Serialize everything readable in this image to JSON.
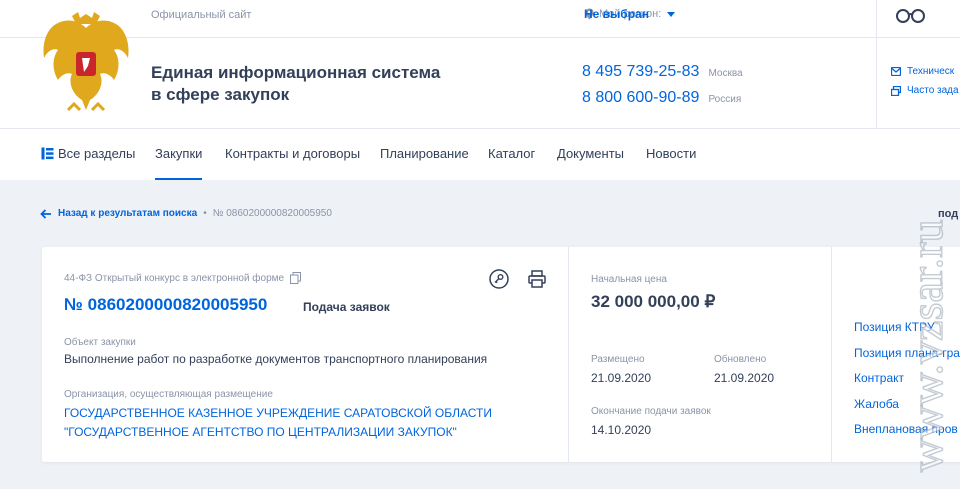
{
  "topbar": {
    "official_label": "Официальный сайт",
    "region_label": "Мой регион:",
    "region_value": "Не выбран"
  },
  "header": {
    "site_title_line1": "Единая информационная система",
    "site_title_line2": "в сфере закупок",
    "phones": [
      {
        "number": "8 495 739-25-83",
        "city": "Москва"
      },
      {
        "number": "8 800 600-90-89",
        "city": "Россия"
      }
    ],
    "support": [
      {
        "label": "Техническ",
        "icon": "envelope-icon"
      },
      {
        "label": "Часто зада",
        "icon": "faq-icon"
      }
    ]
  },
  "nav": {
    "items": [
      {
        "label": "Все разделы"
      },
      {
        "label": "Закупки"
      },
      {
        "label": "Контракты и договоры"
      },
      {
        "label": "Планирование"
      },
      {
        "label": "Каталог"
      },
      {
        "label": "Документы"
      },
      {
        "label": "Новости"
      }
    ],
    "active": "Закупки"
  },
  "breadcrumb": {
    "back_label": "Назад к результатам поиска",
    "separator": "•",
    "current": "№ 0860200000820005950",
    "right_partial": "под"
  },
  "card": {
    "law": "44-ФЗ Открытый конкурс в электронной форме",
    "number": "№ 0860200000820005950",
    "status": "Подача заявок",
    "object_label": "Объект закупки",
    "object_value": "Выполнение работ по разработке документов транспортного планирования",
    "org_label": "Организация, осуществляющая размещение",
    "org_line1": "ГОСУДАРСТВЕННОЕ КАЗЕННОЕ УЧРЕЖДЕНИЕ САРАТОВСКОЙ ОБЛАСТИ",
    "org_line2": "\"ГОСУДАРСТВЕННОЕ АГЕНТСТВО ПО ЦЕНТРАЛИЗАЦИИ ЗАКУПОК\"",
    "price_label": "Начальная цена",
    "price_value": "32 000 000,00 ₽",
    "placed_label": "Размещено",
    "placed_value": "21.09.2020",
    "updated_label": "Обновлено",
    "updated_value": "21.09.2020",
    "deadline_label": "Окончание подачи заявок",
    "deadline_value": "14.10.2020",
    "links": [
      "Позиция КТРУ",
      "Позиция плана-гра",
      "Контракт",
      "Жалоба",
      "Внеплановая пров"
    ]
  },
  "watermark": "www.vzsar.ru",
  "colors": {
    "accent": "#0065dd",
    "text": "#334059",
    "muted": "#8a94a8",
    "background": "#eef1f6"
  }
}
